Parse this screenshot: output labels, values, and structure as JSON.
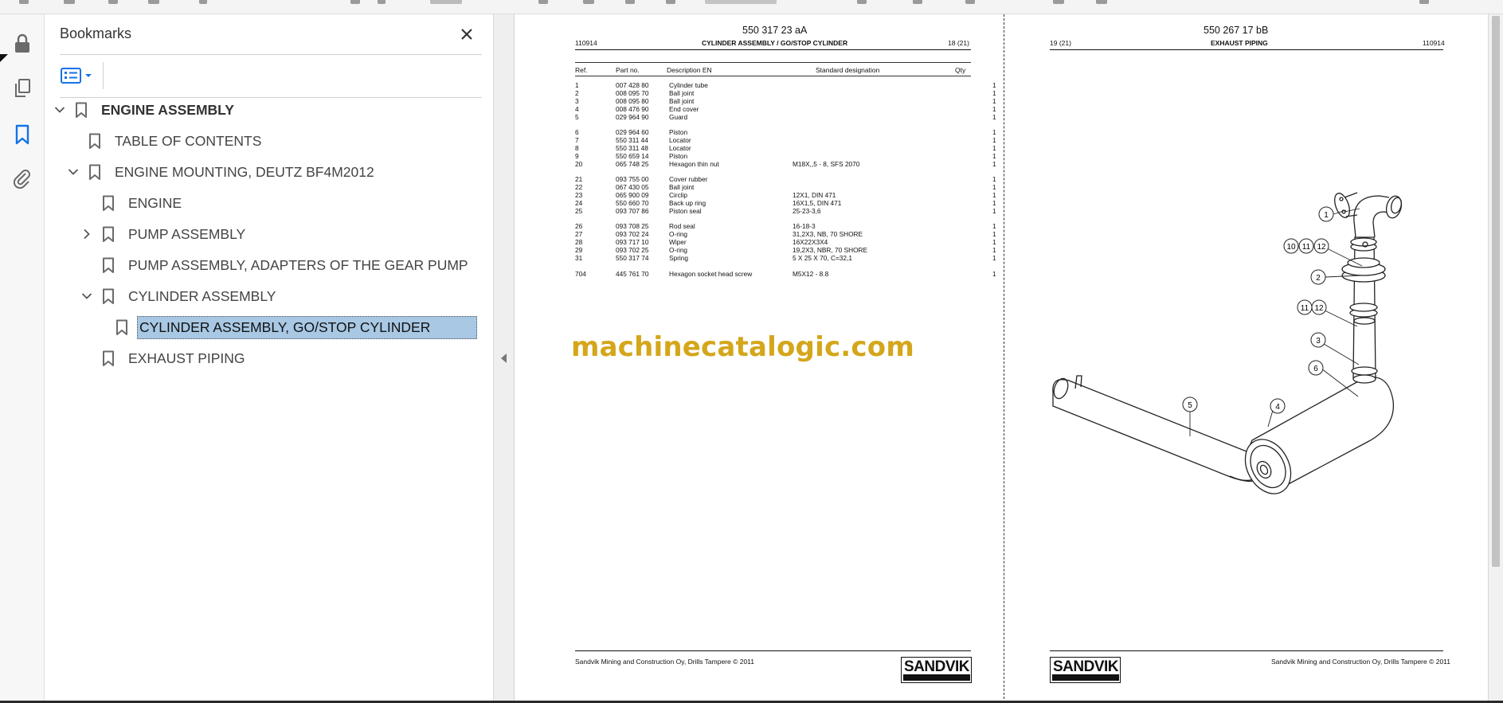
{
  "panel": {
    "title": "Bookmarks",
    "items": [
      {
        "label": "ENGINE ASSEMBLY",
        "level": 0,
        "expander": "expanded"
      },
      {
        "label": "TABLE OF CONTENTS",
        "level": 1,
        "expander": "none"
      },
      {
        "label": "ENGINE MOUNTING, DEUTZ BF4M2012",
        "level": 1,
        "expander": "expanded"
      },
      {
        "label": "ENGINE",
        "level": 2,
        "expander": "none"
      },
      {
        "label": "PUMP ASSEMBLY",
        "level": 2,
        "expander": "collapsed"
      },
      {
        "label": "PUMP ASSEMBLY, ADAPTERS OF THE GEAR PUMP",
        "level": 2,
        "expander": "none"
      },
      {
        "label": "CYLINDER ASSEMBLY",
        "level": 2,
        "expander": "expanded"
      },
      {
        "label": "CYLINDER ASSEMBLY, GO/STOP CYLINDER",
        "level": 3,
        "expander": "none",
        "selected": true
      },
      {
        "label": "EXHAUST PIPING",
        "level": 2,
        "expander": "none"
      }
    ]
  },
  "rail": {
    "icons": [
      "lock-icon",
      "pages-icon",
      "bookmark-icon",
      "attachment-icon"
    ],
    "active": "bookmark-icon"
  },
  "page_left": {
    "doc_number": "550 317 23 aA",
    "date_code": "110914",
    "title": "CYLINDER ASSEMBLY / GO/STOP CYLINDER",
    "page_label": "18 (21)",
    "columns": [
      "Ref.",
      "Part no.",
      "Description EN",
      "Standard designation",
      "Qty"
    ],
    "groups": [
      [
        {
          "ref": "1",
          "part": "007 428 80",
          "desc": "Cylinder tube",
          "std": "",
          "qty": "1"
        },
        {
          "ref": "2",
          "part": "008 095 70",
          "desc": "Ball joint",
          "std": "",
          "qty": "1"
        },
        {
          "ref": "3",
          "part": "008 095 80",
          "desc": "Ball joint",
          "std": "",
          "qty": "1"
        },
        {
          "ref": "4",
          "part": "008 476 90",
          "desc": "End cover",
          "std": "",
          "qty": "1"
        },
        {
          "ref": "5",
          "part": "029 964 90",
          "desc": "Guard",
          "std": "",
          "qty": "1"
        }
      ],
      [
        {
          "ref": "6",
          "part": "029 964 60",
          "desc": "Piston",
          "std": "",
          "qty": "1"
        },
        {
          "ref": "7",
          "part": "550 311 44",
          "desc": "Locator",
          "std": "",
          "qty": "1"
        },
        {
          "ref": "8",
          "part": "550 311 48",
          "desc": "Locator",
          "std": "",
          "qty": "1"
        },
        {
          "ref": "9",
          "part": "550 659 14",
          "desc": "Piston",
          "std": "",
          "qty": "1"
        },
        {
          "ref": "20",
          "part": "065 748 25",
          "desc": "Hexagon thin nut",
          "std": "M18X,,5 - 8, SFS 2070",
          "qty": "1"
        }
      ],
      [
        {
          "ref": "21",
          "part": "093 755 00",
          "desc": "Cover rubber",
          "std": "",
          "qty": "1"
        },
        {
          "ref": "22",
          "part": "067 430 05",
          "desc": "Ball joint",
          "std": "",
          "qty": "1"
        },
        {
          "ref": "23",
          "part": "065 900 09",
          "desc": "Circlip",
          "std": "12X1, DIN 471",
          "qty": "1"
        },
        {
          "ref": "24",
          "part": "550 660 70",
          "desc": "Back up ring",
          "std": "16X1,5, DIN 471",
          "qty": "1"
        },
        {
          "ref": "25",
          "part": "093 707 86",
          "desc": "Piston seal",
          "std": "25-23-3,6",
          "qty": "1"
        }
      ],
      [
        {
          "ref": "26",
          "part": "093 708 25",
          "desc": "Rod seal",
          "std": "16-18-3",
          "qty": "1"
        },
        {
          "ref": "27",
          "part": "093 702 24",
          "desc": "O-ring",
          "std": "31,2X3, NB, 70 SHORE",
          "qty": "1"
        },
        {
          "ref": "28",
          "part": "093 717 10",
          "desc": "Wiper",
          "std": "16X22X3X4",
          "qty": "1"
        },
        {
          "ref": "29",
          "part": "093 702 25",
          "desc": "O-ring",
          "std": "19,2X3, NBR, 70 SHORE",
          "qty": "1"
        },
        {
          "ref": "31",
          "part": "550 317 74",
          "desc": "Spring",
          "std": "5 X 25 X 70, C=32,1",
          "qty": "1"
        }
      ],
      [
        {
          "ref": "704",
          "part": "445 761 70",
          "desc": "Hexagon socket head screw",
          "std": "M5X12 - 8.8",
          "qty": "1"
        }
      ]
    ],
    "watermark": "machinecatalogic.com",
    "footer": "Sandvik Mining and Construction Oy, Drills Tampere © 2011",
    "logo": "SANDVIK"
  },
  "page_right": {
    "doc_number": "550 267 17 bB",
    "page_label": "19 (21)",
    "title": "EXHAUST PIPING",
    "date_code": "110914",
    "footer": "Sandvik Mining and Construction Oy, Drills Tampere © 2011",
    "logo": "SANDVIK",
    "callouts": [
      "1",
      "10",
      "11",
      "12",
      "2",
      "11",
      "12",
      "3",
      "6",
      "4",
      "5"
    ]
  }
}
